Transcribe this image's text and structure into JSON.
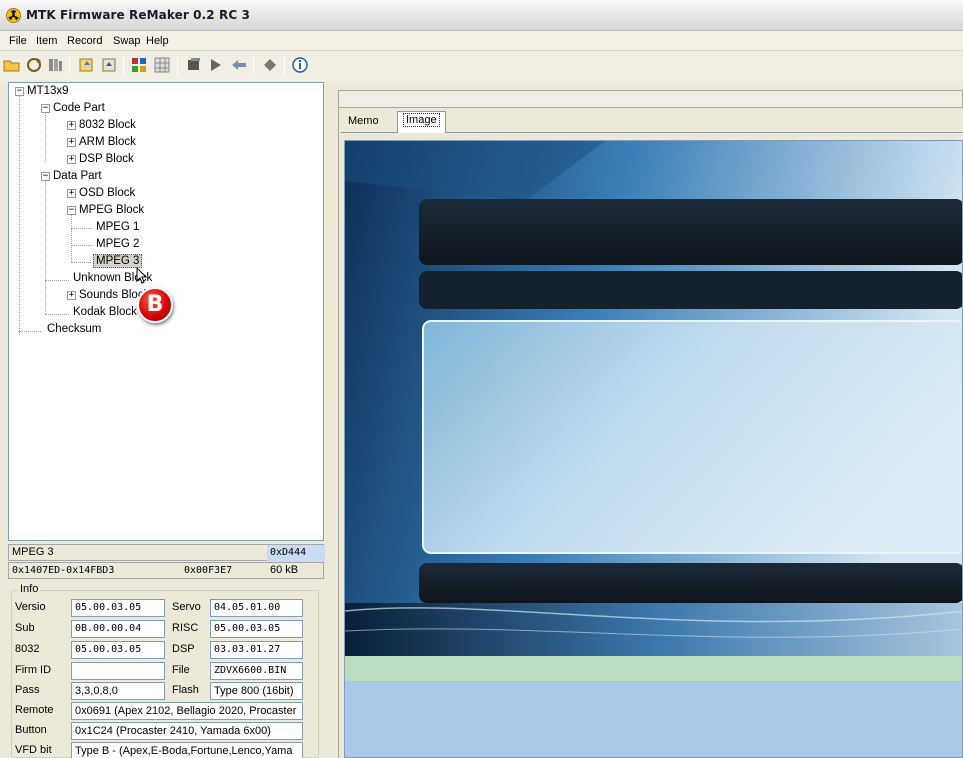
{
  "window": {
    "title": "MTK Firmware ReMaker 0.2 RC 3",
    "icon": "radiation-icon"
  },
  "menu": [
    "File",
    "Item",
    "Record",
    "Swap",
    "Help"
  ],
  "toolbar": {
    "icons": [
      "open-folder-icon",
      "refresh-icon",
      "save-icon",
      "copy-icon",
      "export-icon",
      "chip-icon",
      "chip-grid-icon",
      "block-icon",
      "play-icon",
      "import-icon",
      "erase-icon",
      "info-icon"
    ]
  },
  "tree": {
    "root": "MT13x9",
    "code_part": "Code Part",
    "block_8032": "8032 Block",
    "arm_block": "ARM Block",
    "dsp_block": "DSP Block",
    "data_part": "Data Part",
    "osd_block": "OSD Block",
    "mpeg_block": "MPEG Block",
    "mpeg1": "MPEG 1",
    "mpeg2": "MPEG 2",
    "mpeg3": "MPEG 3",
    "unknown_block": "Unknown Block",
    "sounds_block": "Sounds Block",
    "kodak_block": "Kodak Block",
    "checksum": "Checksum",
    "marker": "B"
  },
  "selection": {
    "name": "MPEG 3",
    "id": "0xD444",
    "range": "0x1407ED-0x14FBD3",
    "size_hex": "0x00F3E7",
    "size_kb": "60 kB"
  },
  "info": {
    "group_title": "Info",
    "version_label": "Versio",
    "version": "05.00.03.05",
    "servo_label": "Servo",
    "servo": "04.05.01.00",
    "sub_label": "Sub",
    "sub": "0B.00.00.04",
    "risc_label": "RISC",
    "risc": "05.00.03.05",
    "c8032_label": "8032",
    "c8032": "05.00.03.05",
    "dsp_label": "DSP",
    "dsp": "03.03.01.27",
    "firmid_label": "Firm ID",
    "firmid": "",
    "file_label": "File",
    "file": "ZDVX6600.BIN",
    "pass_label": "Pass",
    "pass": "3,3,0,8,0",
    "flash_label": "Flash",
    "flash": "Type 800 (16bit)",
    "remote_label": "Remote",
    "remote": "0x0691 (Apex 2102, Bellagio 2020, Procaster",
    "button_label": "Button",
    "button": "0x1C24 (Procaster 2410, Yamada 6x00)",
    "vfd_label": "VFD bit",
    "vfd": "Type B - (Apex,E-Boda,Fortune,Lenco,Yama"
  },
  "tabs": {
    "memo": "Memo",
    "image": "Image"
  }
}
